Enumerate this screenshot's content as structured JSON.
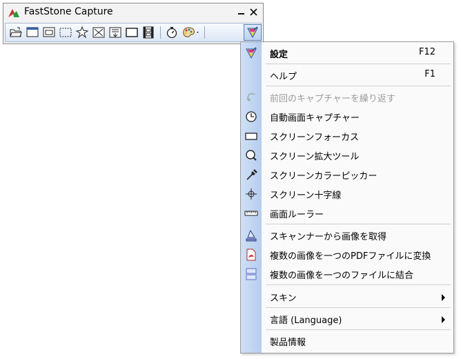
{
  "window": {
    "title": "FastStone Capture"
  },
  "toolbar": {
    "tools": [
      {
        "name": "open-icon"
      },
      {
        "name": "capture-window-icon"
      },
      {
        "name": "capture-object-icon"
      },
      {
        "name": "capture-rectangle-icon"
      },
      {
        "name": "capture-freehand-icon"
      },
      {
        "name": "capture-fullscreen-icon"
      },
      {
        "name": "capture-scrolling-icon"
      },
      {
        "name": "capture-fixed-region-icon"
      },
      {
        "name": "screen-recorder-icon"
      },
      {
        "name": "timer-icon"
      },
      {
        "name": "palette-icon"
      },
      {
        "name": "settings-menu-icon"
      }
    ]
  },
  "menu": {
    "items": [
      {
        "label": "設定",
        "shortcut": "F12",
        "icon": "settings-icon",
        "bold": true
      },
      {
        "label": "ヘルプ",
        "shortcut": "F1"
      },
      {
        "label": "前回のキャプチャーを繰り返す",
        "icon": "repeat-icon",
        "disabled": true
      },
      {
        "label": "自動画面キャプチャー",
        "icon": "clock-icon"
      },
      {
        "label": "スクリーンフォーカス",
        "icon": "rectangle-icon"
      },
      {
        "label": "スクリーン拡大ツール",
        "icon": "magnifier-icon"
      },
      {
        "label": "スクリーンカラーピッカー",
        "icon": "eyedropper-icon"
      },
      {
        "label": "スクリーン十字線",
        "icon": "crosshair-icon"
      },
      {
        "label": "画面ルーラー",
        "icon": "ruler-icon"
      },
      {
        "label": "スキャンナーから画像を取得",
        "icon": "scanner-icon"
      },
      {
        "label": "複数の画像を一つのPDFファイルに変換",
        "icon": "pdf-icon"
      },
      {
        "label": "複数の画像を一つのファイルに結合",
        "icon": "join-images-icon"
      },
      {
        "label": "スキン"
      },
      {
        "label": "言語 (Language)"
      },
      {
        "label": "製品情報"
      }
    ]
  },
  "colors": {
    "menu_strip": "#c4d7f2",
    "toolbar_border": "#5a7fb5"
  }
}
